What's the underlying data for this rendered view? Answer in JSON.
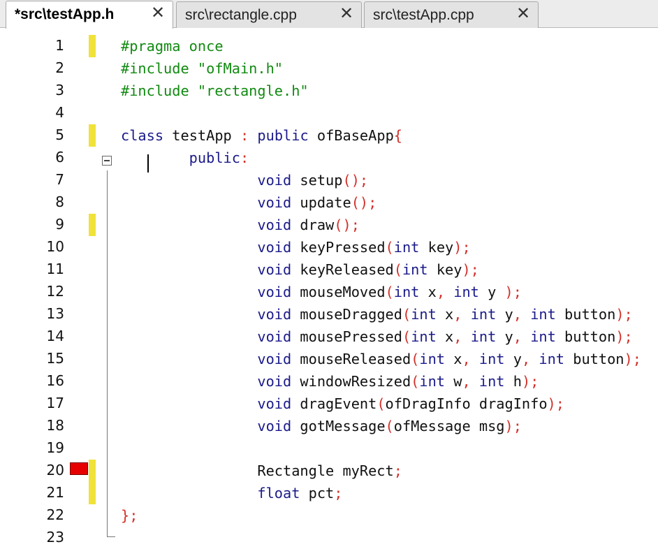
{
  "tabs": [
    {
      "label": "*src\\testApp.h",
      "active": true
    },
    {
      "label": "src\\rectangle.cpp",
      "active": false
    },
    {
      "label": "src\\testApp.cpp",
      "active": false
    }
  ],
  "colors": {
    "preprocessor": "#128a12",
    "keyword": "#1b1b8a",
    "identifier": "#111111",
    "punctuation": "#d2302a",
    "change_marker": "#f0e23a",
    "bookmark": "#e60000"
  },
  "lines": [
    {
      "num": "1",
      "changed": true,
      "tokens": [
        {
          "t": "#pragma once",
          "c": "pp"
        }
      ]
    },
    {
      "num": "2",
      "changed": false,
      "tokens": [
        {
          "t": "#include \"ofMain.h\"",
          "c": "pp"
        }
      ]
    },
    {
      "num": "3",
      "changed": false,
      "tokens": [
        {
          "t": "#include \"rectangle.h\"",
          "c": "pp"
        }
      ]
    },
    {
      "num": "4",
      "changed": false,
      "tokens": []
    },
    {
      "num": "5",
      "changed": true,
      "tokens": [
        {
          "t": "class",
          "c": "kw"
        },
        {
          "t": " testApp ",
          "c": "id"
        },
        {
          "t": ":",
          "c": "p"
        },
        {
          "t": " ",
          "c": "id"
        },
        {
          "t": "public",
          "c": "kw"
        },
        {
          "t": " ofBaseApp",
          "c": "id"
        },
        {
          "t": "{",
          "c": "p"
        }
      ]
    },
    {
      "num": "6",
      "changed": false,
      "tokens": [
        {
          "t": "        public",
          "c": "kw"
        },
        {
          "t": ":",
          "c": "p"
        }
      ]
    },
    {
      "num": "7",
      "changed": false,
      "tokens": [
        {
          "t": "                void",
          "c": "kw"
        },
        {
          "t": " setup",
          "c": "id"
        },
        {
          "t": "();",
          "c": "p"
        }
      ]
    },
    {
      "num": "8",
      "changed": false,
      "tokens": [
        {
          "t": "                void",
          "c": "kw"
        },
        {
          "t": " update",
          "c": "id"
        },
        {
          "t": "();",
          "c": "p"
        }
      ]
    },
    {
      "num": "9",
      "changed": true,
      "tokens": [
        {
          "t": "                void",
          "c": "kw"
        },
        {
          "t": " draw",
          "c": "id"
        },
        {
          "t": "();",
          "c": "p"
        }
      ]
    },
    {
      "num": "10",
      "changed": false,
      "tokens": [
        {
          "t": "                void",
          "c": "kw"
        },
        {
          "t": " keyPressed",
          "c": "id"
        },
        {
          "t": "(",
          "c": "p"
        },
        {
          "t": "int",
          "c": "kw"
        },
        {
          "t": " key",
          "c": "id"
        },
        {
          "t": ");",
          "c": "p"
        }
      ]
    },
    {
      "num": "11",
      "changed": false,
      "tokens": [
        {
          "t": "                void",
          "c": "kw"
        },
        {
          "t": " keyReleased",
          "c": "id"
        },
        {
          "t": "(",
          "c": "p"
        },
        {
          "t": "int",
          "c": "kw"
        },
        {
          "t": " key",
          "c": "id"
        },
        {
          "t": ");",
          "c": "p"
        }
      ]
    },
    {
      "num": "12",
      "changed": false,
      "tokens": [
        {
          "t": "                void",
          "c": "kw"
        },
        {
          "t": " mouseMoved",
          "c": "id"
        },
        {
          "t": "(",
          "c": "p"
        },
        {
          "t": "int",
          "c": "kw"
        },
        {
          "t": " x",
          "c": "id"
        },
        {
          "t": ",",
          "c": "p"
        },
        {
          "t": " ",
          "c": "id"
        },
        {
          "t": "int",
          "c": "kw"
        },
        {
          "t": " y ",
          "c": "id"
        },
        {
          "t": ");",
          "c": "p"
        }
      ]
    },
    {
      "num": "13",
      "changed": false,
      "tokens": [
        {
          "t": "                void",
          "c": "kw"
        },
        {
          "t": " mouseDragged",
          "c": "id"
        },
        {
          "t": "(",
          "c": "p"
        },
        {
          "t": "int",
          "c": "kw"
        },
        {
          "t": " x",
          "c": "id"
        },
        {
          "t": ",",
          "c": "p"
        },
        {
          "t": " ",
          "c": "id"
        },
        {
          "t": "int",
          "c": "kw"
        },
        {
          "t": " y",
          "c": "id"
        },
        {
          "t": ",",
          "c": "p"
        },
        {
          "t": " ",
          "c": "id"
        },
        {
          "t": "int",
          "c": "kw"
        },
        {
          "t": " button",
          "c": "id"
        },
        {
          "t": ");",
          "c": "p"
        }
      ]
    },
    {
      "num": "14",
      "changed": false,
      "tokens": [
        {
          "t": "                void",
          "c": "kw"
        },
        {
          "t": " mousePressed",
          "c": "id"
        },
        {
          "t": "(",
          "c": "p"
        },
        {
          "t": "int",
          "c": "kw"
        },
        {
          "t": " x",
          "c": "id"
        },
        {
          "t": ",",
          "c": "p"
        },
        {
          "t": " ",
          "c": "id"
        },
        {
          "t": "int",
          "c": "kw"
        },
        {
          "t": " y",
          "c": "id"
        },
        {
          "t": ",",
          "c": "p"
        },
        {
          "t": " ",
          "c": "id"
        },
        {
          "t": "int",
          "c": "kw"
        },
        {
          "t": " button",
          "c": "id"
        },
        {
          "t": ");",
          "c": "p"
        }
      ]
    },
    {
      "num": "15",
      "changed": false,
      "tokens": [
        {
          "t": "                void",
          "c": "kw"
        },
        {
          "t": " mouseReleased",
          "c": "id"
        },
        {
          "t": "(",
          "c": "p"
        },
        {
          "t": "int",
          "c": "kw"
        },
        {
          "t": " x",
          "c": "id"
        },
        {
          "t": ",",
          "c": "p"
        },
        {
          "t": " ",
          "c": "id"
        },
        {
          "t": "int",
          "c": "kw"
        },
        {
          "t": " y",
          "c": "id"
        },
        {
          "t": ",",
          "c": "p"
        },
        {
          "t": " ",
          "c": "id"
        },
        {
          "t": "int",
          "c": "kw"
        },
        {
          "t": " button",
          "c": "id"
        },
        {
          "t": ");",
          "c": "p"
        }
      ]
    },
    {
      "num": "16",
      "changed": false,
      "tokens": [
        {
          "t": "                void",
          "c": "kw"
        },
        {
          "t": " windowResized",
          "c": "id"
        },
        {
          "t": "(",
          "c": "p"
        },
        {
          "t": "int",
          "c": "kw"
        },
        {
          "t": " w",
          "c": "id"
        },
        {
          "t": ",",
          "c": "p"
        },
        {
          "t": " ",
          "c": "id"
        },
        {
          "t": "int",
          "c": "kw"
        },
        {
          "t": " h",
          "c": "id"
        },
        {
          "t": ");",
          "c": "p"
        }
      ]
    },
    {
      "num": "17",
      "changed": false,
      "tokens": [
        {
          "t": "                void",
          "c": "kw"
        },
        {
          "t": " dragEvent",
          "c": "id"
        },
        {
          "t": "(",
          "c": "p"
        },
        {
          "t": "ofDragInfo dragInfo",
          "c": "id"
        },
        {
          "t": ");",
          "c": "p"
        }
      ]
    },
    {
      "num": "18",
      "changed": false,
      "tokens": [
        {
          "t": "                void",
          "c": "kw"
        },
        {
          "t": " gotMessage",
          "c": "id"
        },
        {
          "t": "(",
          "c": "p"
        },
        {
          "t": "ofMessage msg",
          "c": "id"
        },
        {
          "t": ");",
          "c": "p"
        }
      ]
    },
    {
      "num": "19",
      "changed": false,
      "tokens": []
    },
    {
      "num": "20",
      "changed": true,
      "bookmark": true,
      "tokens": [
        {
          "t": "                Rectangle myRect",
          "c": "id"
        },
        {
          "t": ";",
          "c": "p"
        }
      ]
    },
    {
      "num": "21",
      "changed": true,
      "tokens": [
        {
          "t": "                float",
          "c": "kw"
        },
        {
          "t": " pct",
          "c": "id"
        },
        {
          "t": ";",
          "c": "p"
        }
      ]
    },
    {
      "num": "22",
      "changed": false,
      "tokens": [
        {
          "t": "};",
          "c": "p"
        }
      ]
    },
    {
      "num": "23",
      "changed": false,
      "tokens": []
    }
  ]
}
